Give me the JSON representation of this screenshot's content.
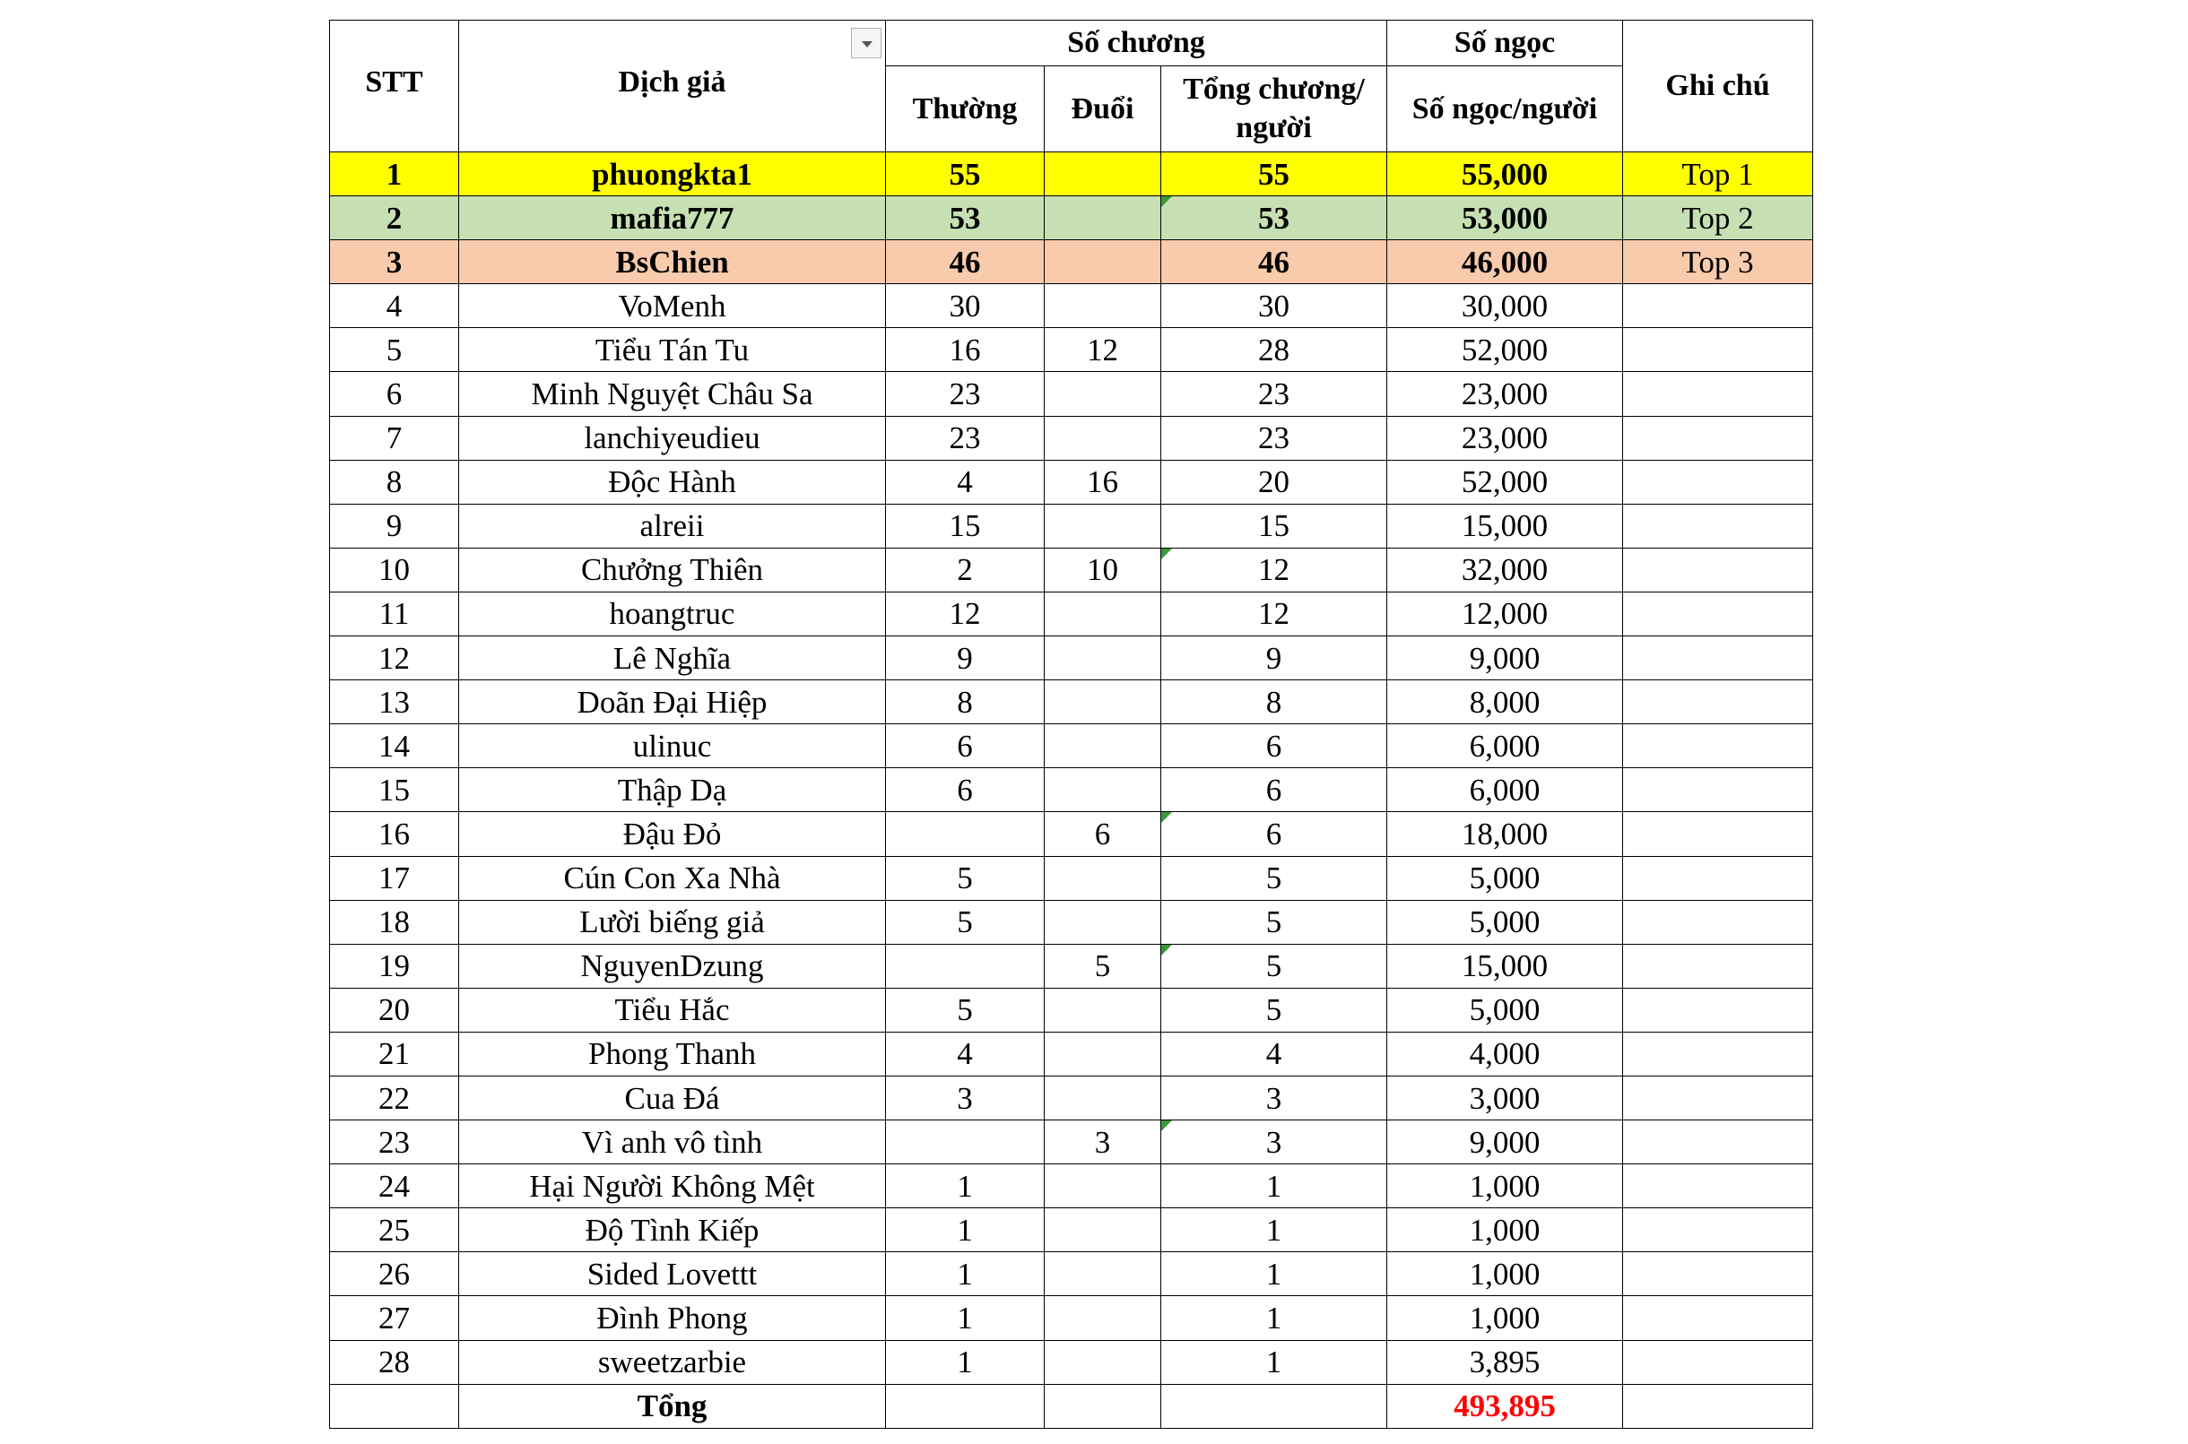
{
  "headers": {
    "stt": "STT",
    "translator": "Dịch giả",
    "chapters_group": "Số chương",
    "normal": "Thường",
    "chase": "Đuổi",
    "total_line1": "Tổng chương/",
    "total_line2": "người",
    "gems_group": "Số ngọc",
    "gems_per_person": "Số ngọc/người",
    "notes": "Ghi chú"
  },
  "colors": {
    "top1": "#ffff00",
    "top2": "#c6e0b4",
    "top3": "#f8cbad",
    "total_gems": "#ff0000",
    "error_marker": "#3a9a3a"
  },
  "rows": [
    {
      "stt": "1",
      "name": "phuongkta1",
      "normal": "55",
      "chase": "",
      "total": "55",
      "gems": "55,000",
      "note": "Top 1",
      "highlight": "top1",
      "bold": true,
      "marker": false
    },
    {
      "stt": "2",
      "name": "mafia777",
      "normal": "53",
      "chase": "",
      "total": "53",
      "gems": "53,000",
      "note": "Top 2",
      "highlight": "top2",
      "bold": true,
      "marker": true
    },
    {
      "stt": "3",
      "name": "BsChien",
      "normal": "46",
      "chase": "",
      "total": "46",
      "gems": "46,000",
      "note": "Top 3",
      "highlight": "top3",
      "bold": true,
      "marker": false
    },
    {
      "stt": "4",
      "name": "VoMenh",
      "normal": "30",
      "chase": "",
      "total": "30",
      "gems": "30,000",
      "note": "",
      "highlight": "",
      "bold": false,
      "marker": false
    },
    {
      "stt": "5",
      "name": "Tiểu Tán Tu",
      "normal": "16",
      "chase": "12",
      "total": "28",
      "gems": "52,000",
      "note": "",
      "highlight": "",
      "bold": false,
      "marker": false
    },
    {
      "stt": "6",
      "name": "Minh Nguyệt Châu Sa",
      "normal": "23",
      "chase": "",
      "total": "23",
      "gems": "23,000",
      "note": "",
      "highlight": "",
      "bold": false,
      "marker": false
    },
    {
      "stt": "7",
      "name": "lanchiyeudieu",
      "normal": "23",
      "chase": "",
      "total": "23",
      "gems": "23,000",
      "note": "",
      "highlight": "",
      "bold": false,
      "marker": false
    },
    {
      "stt": "8",
      "name": "Độc Hành",
      "normal": "4",
      "chase": "16",
      "total": "20",
      "gems": "52,000",
      "note": "",
      "highlight": "",
      "bold": false,
      "marker": false
    },
    {
      "stt": "9",
      "name": "alreii",
      "normal": "15",
      "chase": "",
      "total": "15",
      "gems": "15,000",
      "note": "",
      "highlight": "",
      "bold": false,
      "marker": false
    },
    {
      "stt": "10",
      "name": "Chưởng Thiên",
      "normal": "2",
      "chase": "10",
      "total": "12",
      "gems": "32,000",
      "note": "",
      "highlight": "",
      "bold": false,
      "marker": true
    },
    {
      "stt": "11",
      "name": "hoangtruc",
      "normal": "12",
      "chase": "",
      "total": "12",
      "gems": "12,000",
      "note": "",
      "highlight": "",
      "bold": false,
      "marker": false
    },
    {
      "stt": "12",
      "name": "Lê Nghĩa",
      "normal": "9",
      "chase": "",
      "total": "9",
      "gems": "9,000",
      "note": "",
      "highlight": "",
      "bold": false,
      "marker": false
    },
    {
      "stt": "13",
      "name": "Doãn Đại Hiệp",
      "normal": "8",
      "chase": "",
      "total": "8",
      "gems": "8,000",
      "note": "",
      "highlight": "",
      "bold": false,
      "marker": false
    },
    {
      "stt": "14",
      "name": "ulinuc",
      "normal": "6",
      "chase": "",
      "total": "6",
      "gems": "6,000",
      "note": "",
      "highlight": "",
      "bold": false,
      "marker": false
    },
    {
      "stt": "15",
      "name": "Thập Dạ",
      "normal": "6",
      "chase": "",
      "total": "6",
      "gems": "6,000",
      "note": "",
      "highlight": "",
      "bold": false,
      "marker": false
    },
    {
      "stt": "16",
      "name": "Đậu Đỏ",
      "normal": "",
      "chase": "6",
      "total": "6",
      "gems": "18,000",
      "note": "",
      "highlight": "",
      "bold": false,
      "marker": true
    },
    {
      "stt": "17",
      "name": "Cún Con Xa Nhà",
      "normal": "5",
      "chase": "",
      "total": "5",
      "gems": "5,000",
      "note": "",
      "highlight": "",
      "bold": false,
      "marker": false
    },
    {
      "stt": "18",
      "name": "Lười biếng giả",
      "normal": "5",
      "chase": "",
      "total": "5",
      "gems": "5,000",
      "note": "",
      "highlight": "",
      "bold": false,
      "marker": false
    },
    {
      "stt": "19",
      "name": "NguyenDzung",
      "normal": "",
      "chase": "5",
      "total": "5",
      "gems": "15,000",
      "note": "",
      "highlight": "",
      "bold": false,
      "marker": true
    },
    {
      "stt": "20",
      "name": "Tiểu Hắc",
      "normal": "5",
      "chase": "",
      "total": "5",
      "gems": "5,000",
      "note": "",
      "highlight": "",
      "bold": false,
      "marker": false
    },
    {
      "stt": "21",
      "name": "Phong Thanh",
      "normal": "4",
      "chase": "",
      "total": "4",
      "gems": "4,000",
      "note": "",
      "highlight": "",
      "bold": false,
      "marker": false
    },
    {
      "stt": "22",
      "name": "Cua Đá",
      "normal": "3",
      "chase": "",
      "total": "3",
      "gems": "3,000",
      "note": "",
      "highlight": "",
      "bold": false,
      "marker": false
    },
    {
      "stt": "23",
      "name": "Vì anh vô tình",
      "normal": "",
      "chase": "3",
      "total": "3",
      "gems": "9,000",
      "note": "",
      "highlight": "",
      "bold": false,
      "marker": true
    },
    {
      "stt": "24",
      "name": "Hại Người Không Mệt",
      "normal": "1",
      "chase": "",
      "total": "1",
      "gems": "1,000",
      "note": "",
      "highlight": "",
      "bold": false,
      "marker": false
    },
    {
      "stt": "25",
      "name": "Độ Tình Kiếp",
      "normal": "1",
      "chase": "",
      "total": "1",
      "gems": "1,000",
      "note": "",
      "highlight": "",
      "bold": false,
      "marker": false
    },
    {
      "stt": "26",
      "name": "Sided Lovettt",
      "normal": "1",
      "chase": "",
      "total": "1",
      "gems": "1,000",
      "note": "",
      "highlight": "",
      "bold": false,
      "marker": false
    },
    {
      "stt": "27",
      "name": "Đình Phong",
      "normal": "1",
      "chase": "",
      "total": "1",
      "gems": "1,000",
      "note": "",
      "highlight": "",
      "bold": false,
      "marker": false
    },
    {
      "stt": "28",
      "name": "sweetzarbie",
      "normal": "1",
      "chase": "",
      "total": "1",
      "gems": "3,895",
      "note": "",
      "highlight": "",
      "bold": false,
      "marker": false
    }
  ],
  "total_row": {
    "label": "Tổng",
    "gems": "493,895"
  }
}
